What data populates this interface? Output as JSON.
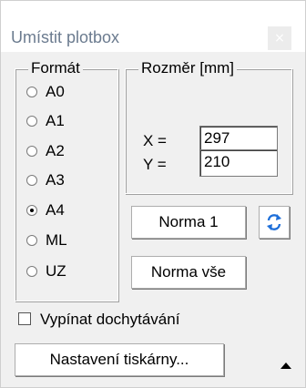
{
  "window": {
    "title": "Umístit plotbox",
    "close_icon": "×"
  },
  "format_group": {
    "legend": "Formát",
    "options": [
      {
        "label": "A0",
        "checked": false
      },
      {
        "label": "A1",
        "checked": false
      },
      {
        "label": "A2",
        "checked": false
      },
      {
        "label": "A3",
        "checked": false
      },
      {
        "label": "A4",
        "checked": true
      },
      {
        "label": "ML",
        "checked": false
      },
      {
        "label": "UZ",
        "checked": false
      }
    ]
  },
  "size_group": {
    "legend": "Rozměr [mm]",
    "x_label": "X =",
    "x_value": "297",
    "y_label": "Y =",
    "y_value": "210"
  },
  "buttons": {
    "norma1": "Norma 1",
    "swap_icon": "swap-arrows-icon",
    "norma_vse": "Norma vše",
    "printer_settings": "Nastavení tiskárny..."
  },
  "checkbox": {
    "label": "Vypínat dochytávání",
    "checked": false
  },
  "colors": {
    "swap_icon": "#1e6fd9",
    "title": "#6b7b8f"
  }
}
